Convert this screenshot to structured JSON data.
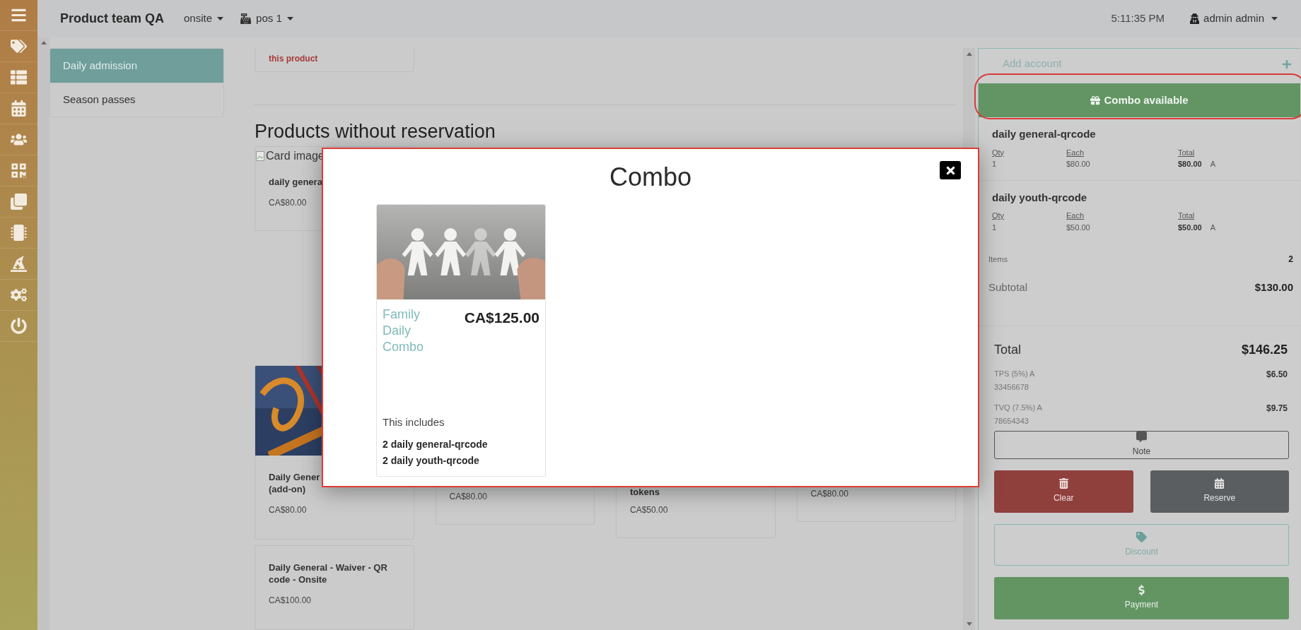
{
  "topbar": {
    "title": "Product team QA",
    "location": "onsite",
    "register": "pos 1",
    "time": "5:11:35 PM",
    "user": "admin admin"
  },
  "categories": [
    {
      "label": "Daily admission",
      "selected": true
    },
    {
      "label": "Season passes",
      "selected": false
    }
  ],
  "products": {
    "notice": "this product",
    "heading": "Products without reservation",
    "rows": [
      [
        {
          "kind": "broken-image",
          "image_alt": "Card image",
          "name_lines": [
            "daily genera"
          ],
          "price": "CA$80.00"
        }
      ],
      [
        {
          "kind": "picture",
          "name_lines": [
            "Daily Gener",
            "(add-on)"
          ],
          "price": "CA$80.00"
        },
        {
          "kind": "covered",
          "price": "CA$80.00"
        },
        {
          "kind": "covered",
          "name_lines": [
            "tokens"
          ],
          "price": "CA$50.00"
        },
        {
          "kind": "covered",
          "price": "CA$80.00"
        }
      ],
      [
        {
          "kind": "plain",
          "name_lines": [
            "Daily General - Waiver - QR code - Onsite"
          ],
          "price": "CA$100.00"
        }
      ]
    ]
  },
  "modal": {
    "title": "Combo",
    "combos": [
      {
        "name": "Family Daily Combo",
        "price": "CA$125.00",
        "includes_label": "This includes",
        "includes": [
          "2 daily general-qrcode",
          "2 daily youth-qrcode"
        ]
      }
    ]
  },
  "cart": {
    "add_account_placeholder": "Add account",
    "combo_button": "Combo available",
    "items": [
      {
        "name": "daily general-qrcode",
        "qty_label": "Qty",
        "each_label": "Each",
        "total_label": "Total",
        "qty": "1",
        "each": "$80.00",
        "total": "$80.00",
        "tax_code": "A"
      },
      {
        "name": "daily youth-qrcode",
        "qty_label": "Qty",
        "each_label": "Each",
        "total_label": "Total",
        "qty": "1",
        "each": "$50.00",
        "total": "$50.00",
        "tax_code": "A"
      }
    ],
    "summary": [
      {
        "kind": "count",
        "label": "Items",
        "value": "2"
      },
      {
        "kind": "subtotal",
        "label": "Subtotal",
        "value": "$130.00"
      }
    ],
    "total": {
      "label": "Total",
      "value": "$146.25"
    },
    "taxes": [
      {
        "label": "TPS (5%) A",
        "number": "33456678",
        "value": "$6.50"
      },
      {
        "label": "TVQ (7.5%) A",
        "number": "78654343",
        "value": "$9.75"
      }
    ],
    "buttons": [
      {
        "kind": "note",
        "label": "Note"
      },
      {
        "kind": "clear",
        "label": "Clear"
      },
      {
        "kind": "reserve",
        "label": "Reserve"
      },
      {
        "kind": "discount",
        "label": "Discount"
      },
      {
        "kind": "payment",
        "label": "Payment"
      }
    ]
  }
}
